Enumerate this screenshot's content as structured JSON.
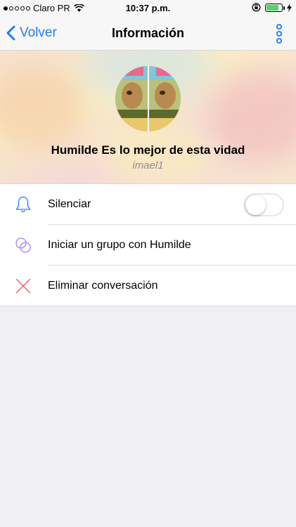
{
  "status_bar": {
    "carrier": "Claro PR",
    "time": "10:37 p.m.",
    "signal_bars_filled": 1,
    "signal_bars_total": 5,
    "battery_level": 0.8
  },
  "nav": {
    "back_label": "Volver",
    "title": "Información"
  },
  "profile": {
    "name": "Humilde Es lo mejor de esta vidad",
    "handle": "imael1"
  },
  "options": [
    {
      "label": "Silenciar",
      "icon": "bell-icon",
      "toggle": false
    },
    {
      "label": "Iniciar un grupo con Humilde",
      "icon": "group-icon"
    },
    {
      "label": "Eliminar conversación",
      "icon": "close-icon"
    }
  ],
  "colors": {
    "accent": "#1f7cf5",
    "group_icon": "#a77df0",
    "delete_icon": "#f2565d",
    "background": "#efeff4"
  }
}
